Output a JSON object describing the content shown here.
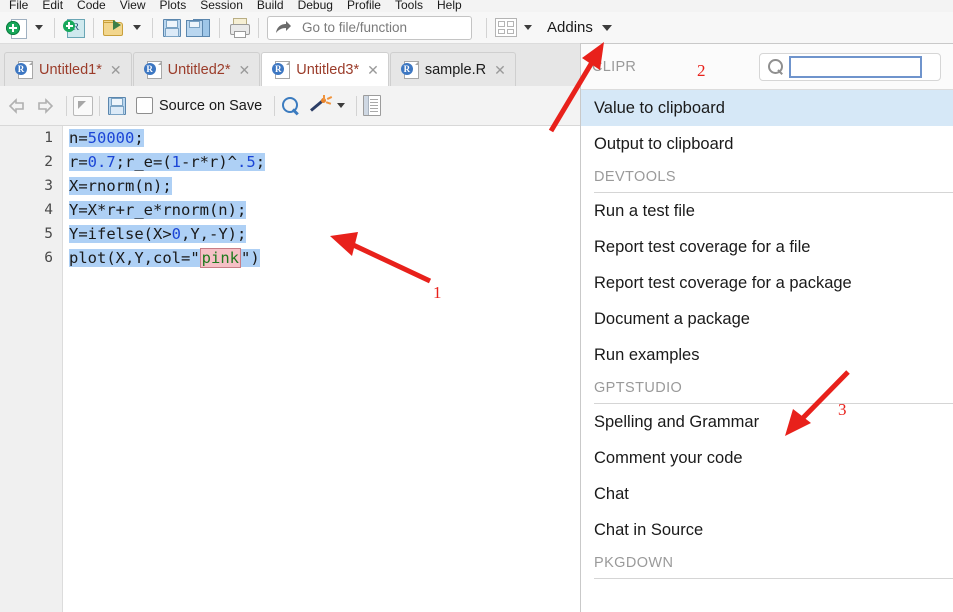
{
  "app": {
    "menubar": [
      {
        "label": "File"
      },
      {
        "label": "Edit"
      },
      {
        "label": "Code"
      },
      {
        "label": "View"
      },
      {
        "label": "Plots"
      },
      {
        "label": "Session"
      },
      {
        "label": "Build"
      },
      {
        "label": "Debug"
      },
      {
        "label": "Profile"
      },
      {
        "label": "Tools"
      },
      {
        "label": "Help"
      }
    ],
    "toolbar": {
      "new_file_icon": "new-file-icon",
      "new_project_icon": "new-project-icon",
      "open_file_icon": "open-folder-icon",
      "save_icon": "save-icon",
      "save_all_icon": "save-all-icon",
      "print_icon": "print-icon",
      "goto_placeholder": "Go to file/function",
      "goto_value": "",
      "panes_icon": "pane-layout-icon",
      "addins_label": "Addins"
    }
  },
  "source_tabs": [
    {
      "label": "Untitled1*",
      "modified": true,
      "active": false
    },
    {
      "label": "Untitled2*",
      "modified": true,
      "active": false
    },
    {
      "label": "Untitled3*",
      "modified": true,
      "active": true
    },
    {
      "label": "sample.R",
      "modified": false,
      "active": false
    }
  ],
  "editor_toolbar": {
    "back_icon": "back-arrow-icon",
    "forward_icon": "forward-arrow-icon",
    "popout_icon": "show-in-new-window-icon",
    "save_icon": "save-icon",
    "source_on_save_label": "Source on Save",
    "source_on_save_checked": false,
    "find_icon": "find-replace-icon",
    "magic_icon": "code-tools-icon",
    "outline_icon": "document-outline-icon"
  },
  "code": {
    "lines": [
      {
        "n": "1",
        "text": "n=50000;"
      },
      {
        "n": "2",
        "text": "r=0.7;r_e=(1-r*r)^.5;"
      },
      {
        "n": "3",
        "text": "X=rnorm(n);"
      },
      {
        "n": "4",
        "text": "Y=X*r+r_e*rnorm(n);"
      },
      {
        "n": "5",
        "text": "Y=ifelse(X>0,Y,-Y);"
      },
      {
        "n": "6",
        "text": "plot(X,Y,col=\"pink\")"
      }
    ],
    "color_literal": "pink",
    "selection_color": "#aed0f5",
    "number_color": "#1b45d6",
    "color_literal_text_color": "#1f7a1f",
    "color_literal_bg": "#f6c0c6"
  },
  "addins_panel": {
    "search": {
      "value": "",
      "placeholder": "",
      "icon": "search-icon"
    },
    "entries": [
      {
        "type": "group",
        "label": "CLIPR"
      },
      {
        "type": "item",
        "label": "Value to clipboard",
        "selected": true
      },
      {
        "type": "item",
        "label": "Output to clipboard",
        "selected": false
      },
      {
        "type": "group",
        "label": "DEVTOOLS"
      },
      {
        "type": "divider"
      },
      {
        "type": "item",
        "label": "Run a test file",
        "selected": false
      },
      {
        "type": "item",
        "label": "Report test coverage for a file",
        "selected": false
      },
      {
        "type": "item",
        "label": "Report test coverage for a package",
        "selected": false
      },
      {
        "type": "item",
        "label": "Document a package",
        "selected": false
      },
      {
        "type": "item",
        "label": "Run examples",
        "selected": false
      },
      {
        "type": "group",
        "label": "GPTSTUDIO"
      },
      {
        "type": "divider"
      },
      {
        "type": "item",
        "label": "Spelling and Grammar",
        "selected": false
      },
      {
        "type": "item",
        "label": "Comment your code",
        "selected": false
      },
      {
        "type": "item",
        "label": "Chat",
        "selected": false
      },
      {
        "type": "item",
        "label": "Chat in Source",
        "selected": false
      },
      {
        "type": "group",
        "label": "PKGDOWN"
      },
      {
        "type": "divider"
      }
    ]
  },
  "annotations": {
    "color": "#e8211b",
    "markers": [
      {
        "label": "1"
      },
      {
        "label": "2"
      },
      {
        "label": "3"
      }
    ]
  }
}
